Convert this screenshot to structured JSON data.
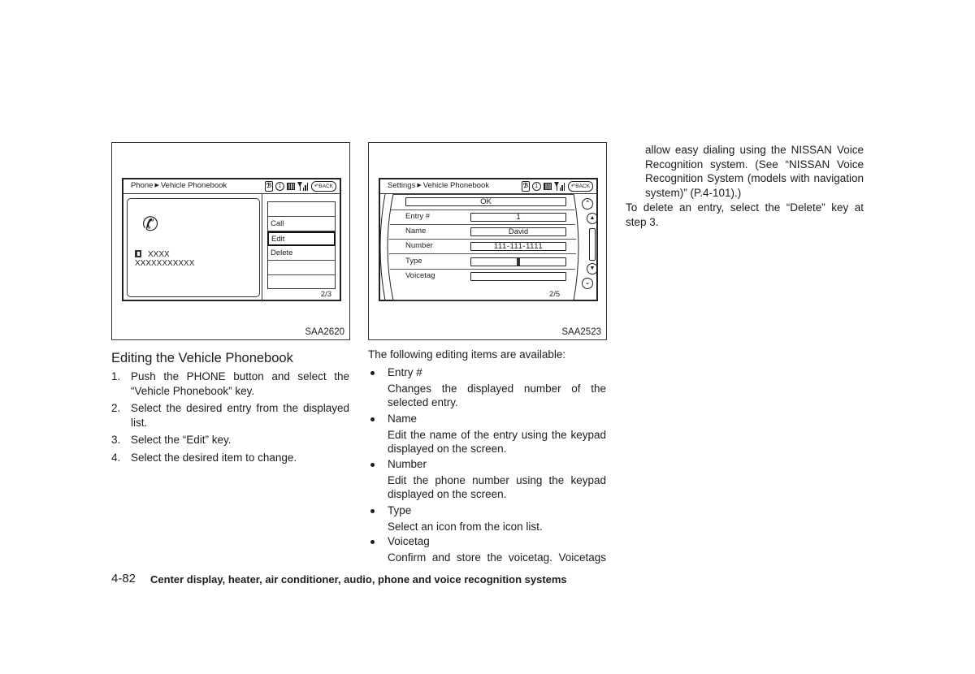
{
  "figures": [
    {
      "id": "SAA2620",
      "label": "SAA2620",
      "screen": {
        "breadcrumb": [
          "Phone",
          "Vehicle Phonebook"
        ],
        "status_icons": [
          "bluetooth-icon",
          "info-icon",
          "battery-icon",
          "signal-icon"
        ],
        "back_label": "BACK",
        "contact": {
          "icon": "phone-handset-icon",
          "name": "XXXX",
          "number": "XXXXXXXXXXX",
          "type_icon": "phonebook-type-icon"
        },
        "menu": [
          "",
          "Call",
          "Edit",
          "Delete",
          "",
          ""
        ],
        "selected": "Edit",
        "page": "2/3"
      }
    },
    {
      "id": "SAA2523",
      "label": "SAA2523",
      "screen": {
        "breadcrumb": [
          "Settings",
          "Vehicle Phonebook"
        ],
        "status_icons": [
          "bluetooth-icon",
          "info-icon",
          "battery-icon",
          "signal-icon"
        ],
        "back_label": "BACK",
        "ok_label": "OK",
        "rows": [
          {
            "label": "Entry #",
            "value": "1"
          },
          {
            "label": "Name",
            "value": "David"
          },
          {
            "label": "Number",
            "value": "111-111-1111"
          },
          {
            "label": "Type",
            "value": ""
          },
          {
            "label": "Voicetag",
            "value": ""
          }
        ],
        "page": "2/5",
        "scroll_buttons": [
          "page-up-icon",
          "scroll-up-icon",
          "scroll-down-icon",
          "page-down-icon"
        ]
      }
    }
  ],
  "left_column": {
    "heading": "Editing the Vehicle Phonebook",
    "steps": [
      {
        "n": "1.",
        "lines": [
          "Push the PHONE button and select the",
          "“Vehicle Phonebook” key."
        ]
      },
      {
        "n": "2.",
        "lines": [
          "Select the desired entry from the displayed",
          "list."
        ]
      },
      {
        "n": "3.",
        "lines": [
          "Select the “Edit” key."
        ]
      },
      {
        "n": "4.",
        "lines": [
          "Select the desired item to change."
        ]
      }
    ]
  },
  "middle_column": {
    "intro": "The following editing items are available:",
    "items": [
      {
        "title": "Entry #",
        "lines": [
          "Changes the displayed number of the",
          "selected entry."
        ]
      },
      {
        "title": "Name",
        "lines": [
          "Edit the name of the entry using the keypad",
          "displayed on the screen."
        ]
      },
      {
        "title": "Number",
        "lines": [
          "Edit the phone number using the keypad",
          "displayed on the screen."
        ]
      },
      {
        "title": "Type",
        "lines": [
          "Select an icon from the icon list."
        ]
      },
      {
        "title": "Voicetag",
        "lines": [
          "Confirm and store the voicetag. Voicetags"
        ]
      }
    ]
  },
  "right_column": {
    "continuation_lines": [
      "allow easy dialing using the NISSAN Voice",
      "Recognition system. (See “NISSAN Voice",
      "Recognition System (models with navigation",
      "system)” (P.4-101).)"
    ],
    "para_lines": [
      "To delete an entry, select the “Delete” key at",
      "step 3."
    ]
  },
  "footer": {
    "page_number": "4-82",
    "section_title": "Center display, heater, air conditioner, audio, phone and voice recognition systems"
  }
}
